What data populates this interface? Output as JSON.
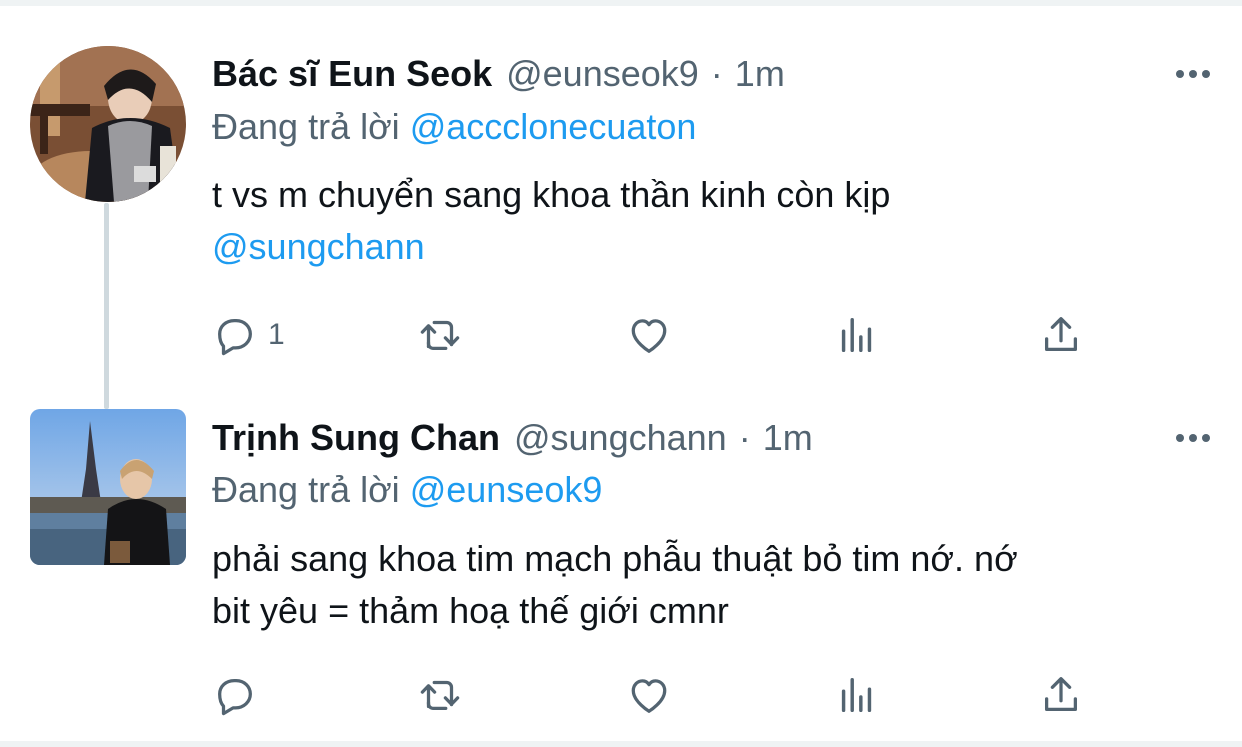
{
  "tweets": [
    {
      "name": "Bác sĩ Eun Seok",
      "handle": "@eunseok9",
      "separator": "·",
      "time": "1m",
      "replying_prefix": "Đang trả lời",
      "replying_to": "@accclonecuaton",
      "body_line1": "t vs m chuyển sang khoa thần kinh còn kịp",
      "body_mention": "@sungchann",
      "reply_count": "1",
      "icons": [
        "reply-icon",
        "retweet-icon",
        "like-icon",
        "views-icon",
        "share-icon",
        "more-icon"
      ]
    },
    {
      "name": "Trịnh Sung Chan",
      "handle": "@sungchann",
      "separator": "·",
      "time": "1m",
      "replying_prefix": "Đang trả lời",
      "replying_to": "@eunseok9",
      "body_line1": "phải sang khoa tim mạch phẫu thuật bỏ tim nớ. nớ",
      "body_line2": "bit yêu = thảm hoạ thế giới cmnr",
      "reply_count": "",
      "icons": [
        "reply-icon",
        "retweet-icon",
        "like-icon",
        "views-icon",
        "share-icon",
        "more-icon"
      ]
    }
  ],
  "colors": {
    "mention": "#1d9bf0",
    "secondary_text": "#536471",
    "thread_line": "#cfd9de"
  }
}
